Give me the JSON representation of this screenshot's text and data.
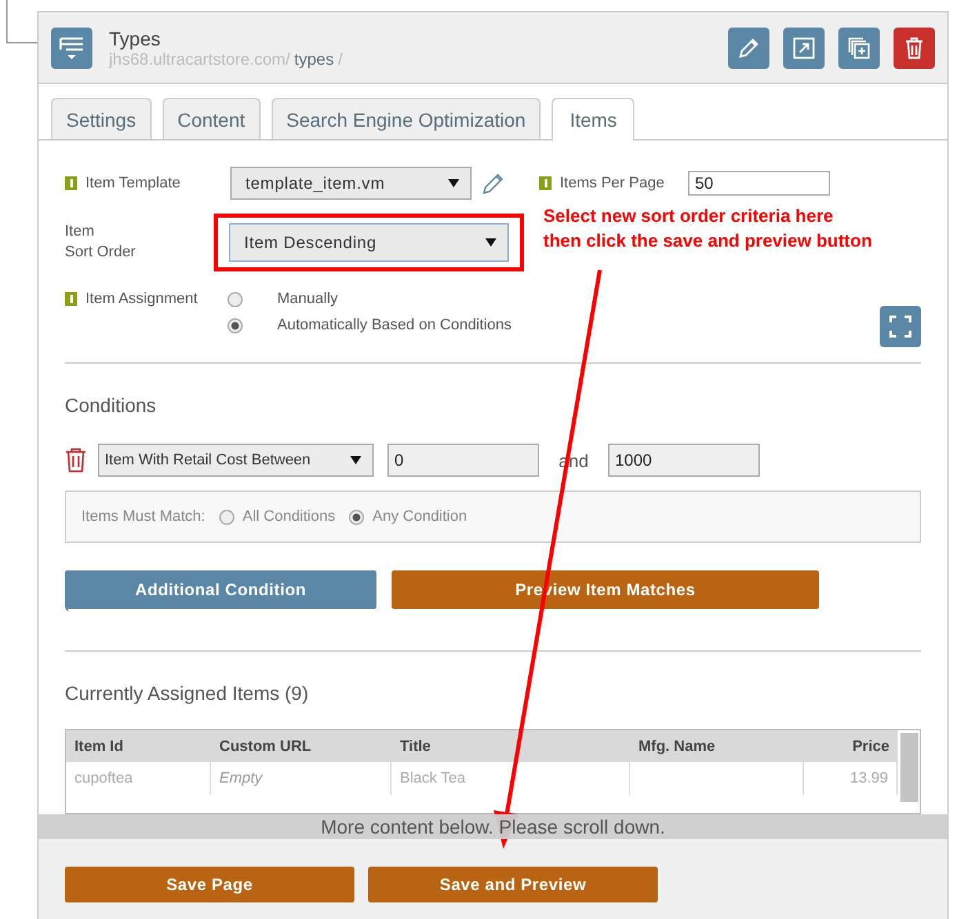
{
  "header": {
    "title": "Types",
    "breadcrumb": [
      {
        "text": "jhs68.ultracartstore.com/",
        "strong": false
      },
      {
        "text": "types",
        "strong": true
      },
      {
        "text": "/",
        "strong": false
      }
    ],
    "actions": [
      {
        "kind": "edit"
      },
      {
        "kind": "open"
      },
      {
        "kind": "copy"
      },
      {
        "kind": "delete"
      }
    ]
  },
  "tabs": [
    {
      "label": "Settings",
      "selected": false
    },
    {
      "label": "Content",
      "selected": false
    },
    {
      "label": "Search Engine Optimization",
      "selected": false
    },
    {
      "label": "Items",
      "selected": true
    }
  ],
  "item_template": {
    "label": "Item Template",
    "info": true,
    "value": "template_item.vm"
  },
  "items_per_page": {
    "label": "Items Per Page",
    "info": true,
    "value": "50"
  },
  "sort_order": {
    "label_lines": [
      "Item",
      "Sort Order"
    ],
    "value": "Item Descending"
  },
  "annotation": {
    "lines": [
      "Select new sort order criteria here",
      "then click the save and preview button"
    ]
  },
  "item_assignment": {
    "label": "Item Assignment",
    "info": true,
    "options": [
      {
        "label": "Manually",
        "selected": false
      },
      {
        "label": "Automatically Based on Conditions",
        "selected": true
      }
    ]
  },
  "conditions": {
    "title": "Conditions",
    "rows": [
      {
        "field": "Item With Retail Cost Between",
        "from": "0",
        "joiner": "and",
        "to": "1000"
      }
    ],
    "match": {
      "label": "Items Must Match:",
      "options": [
        {
          "label": "All Conditions",
          "selected": false
        },
        {
          "label": "Any Condition",
          "selected": true
        }
      ]
    },
    "buttons": [
      {
        "label": "Additional Condition",
        "kind": "secondary"
      },
      {
        "label": "Preview Item Matches",
        "kind": "primary"
      }
    ],
    "stray_mark": "`"
  },
  "assigned": {
    "title": "Currently Assigned Items (9)",
    "columns": [
      "Item Id",
      "Custom URL",
      "Title",
      "Mfg. Name",
      "Price"
    ],
    "rows": [
      [
        {
          "text": "cupoftea",
          "empty": false
        },
        {
          "text": "Empty",
          "empty": true
        },
        {
          "text": "Black Tea",
          "empty": false
        },
        {},
        {
          "text": "13.99",
          "empty": false
        }
      ]
    ]
  },
  "scroll_notice": "More content below. Please scroll down.",
  "footer_buttons": [
    "Save Page",
    "Save and Preview"
  ]
}
